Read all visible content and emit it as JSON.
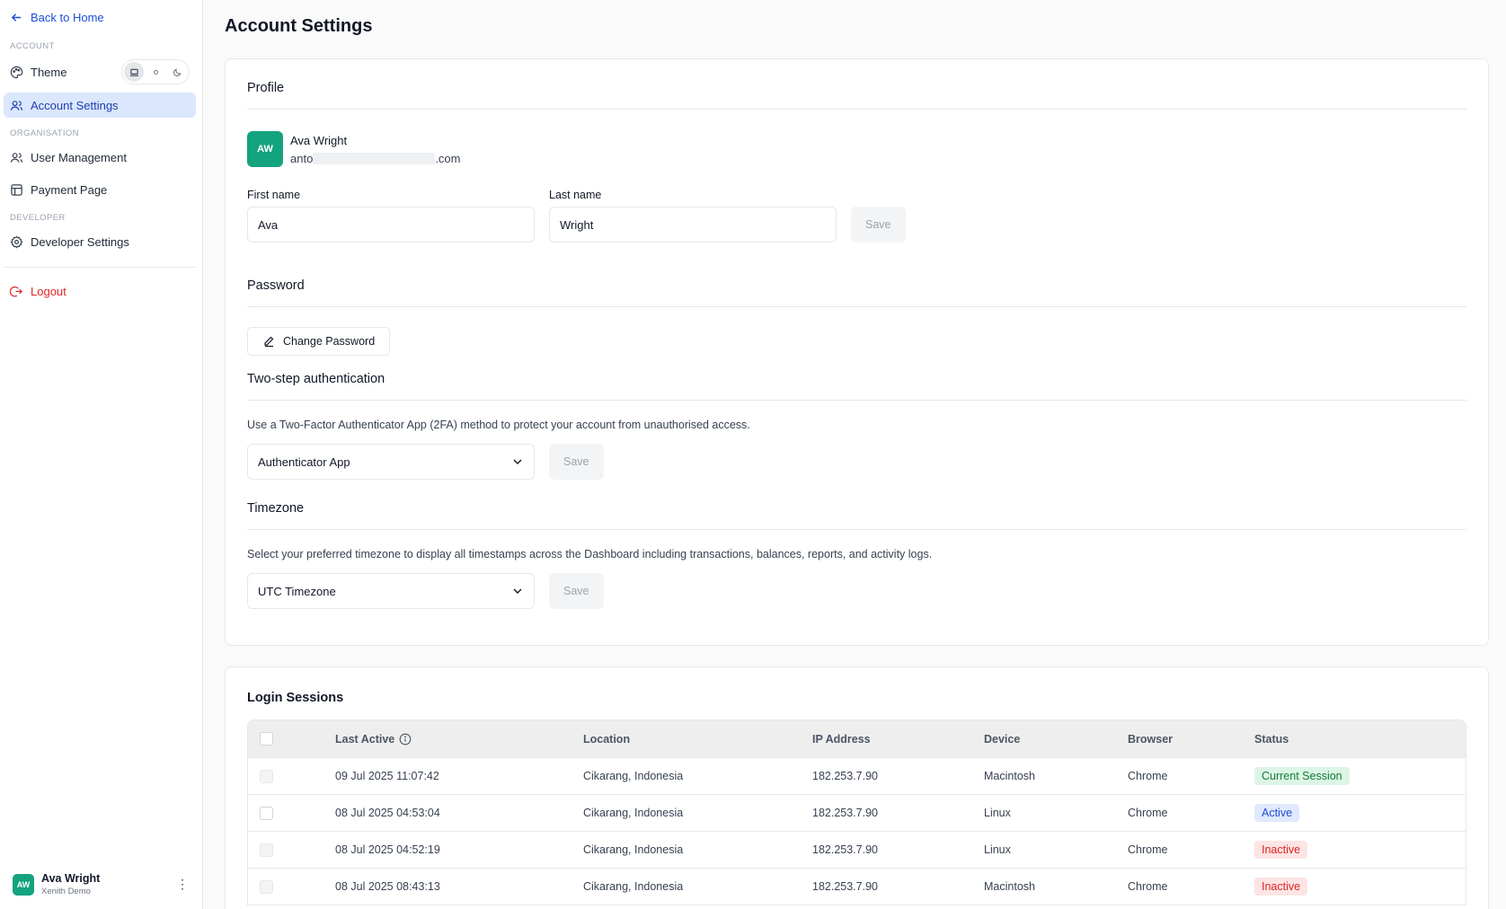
{
  "sidebar": {
    "back_label": "Back to Home",
    "section_account": "ACCOUNT",
    "theme_label": "Theme",
    "theme_options": [
      "laptop-icon",
      "sun-icon",
      "moon-icon"
    ],
    "theme_selected": "system",
    "account_settings_label": "Account Settings",
    "section_org": "ORGANISATION",
    "user_management_label": "User Management",
    "payment_page_label": "Payment Page",
    "section_dev": "DEVELOPER",
    "developer_settings_label": "Developer Settings",
    "logout_label": "Logout",
    "user": {
      "initials": "AW",
      "name": "Ava Wright",
      "org": "Xenith Demo"
    }
  },
  "page": {
    "title": "Account Settings"
  },
  "profile": {
    "section_title": "Profile",
    "initials": "AW",
    "name": "Ava Wright",
    "email_prefix": "anto",
    "email_suffix": ".com",
    "first_name_label": "First name",
    "first_name_value": "Ava",
    "last_name_label": "Last name",
    "last_name_value": "Wright",
    "save_label": "Save"
  },
  "password": {
    "section_title": "Password",
    "change_label": "Change Password"
  },
  "two_step": {
    "section_title": "Two-step authentication",
    "description": "Use a Two-Factor Authenticator App (2FA) method to protect your account from unauthorised access.",
    "selected": "Authenticator App",
    "save_label": "Save"
  },
  "timezone": {
    "section_title": "Timezone",
    "description": "Select your preferred timezone to display all timestamps across the Dashboard including transactions, balances, reports, and activity logs.",
    "selected": "UTC Timezone",
    "save_label": "Save"
  },
  "sessions": {
    "title": "Login Sessions",
    "columns": {
      "last_active": "Last Active",
      "location": "Location",
      "ip": "IP Address",
      "device": "Device",
      "browser": "Browser",
      "status": "Status"
    },
    "rows": [
      {
        "last_active": "09 Jul 2025 11:07:42",
        "location": "Cikarang, Indonesia",
        "ip": "182.253.7.90",
        "device": "Macintosh",
        "browser": "Chrome",
        "status": "Current Session"
      },
      {
        "last_active": "08 Jul 2025 04:53:04",
        "location": "Cikarang, Indonesia",
        "ip": "182.253.7.90",
        "device": "Linux",
        "browser": "Chrome",
        "status": "Active"
      },
      {
        "last_active": "08 Jul 2025 04:52:19",
        "location": "Cikarang, Indonesia",
        "ip": "182.253.7.90",
        "device": "Linux",
        "browser": "Chrome",
        "status": "Inactive"
      },
      {
        "last_active": "08 Jul 2025 08:43:13",
        "location": "Cikarang, Indonesia",
        "ip": "182.253.7.90",
        "device": "Macintosh",
        "browser": "Chrome",
        "status": "Inactive"
      }
    ]
  },
  "colors": {
    "accent": "#1d4ed8",
    "avatar": "#14a37f",
    "danger": "#dc2626",
    "active_nav_bg": "#dbe7fd"
  }
}
